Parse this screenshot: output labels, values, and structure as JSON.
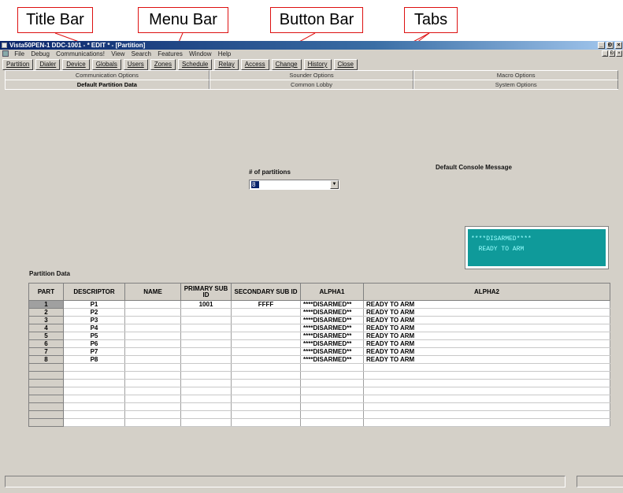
{
  "callouts": {
    "title_bar": "Title Bar",
    "menu_bar": "Menu Bar",
    "button_bar": "Button Bar",
    "tabs": "Tabs"
  },
  "window": {
    "title": "Vista50PEN-1  DDC-1001  - * EDIT * - [Partition]",
    "controls": [
      "_",
      "Ɖ",
      "×"
    ]
  },
  "menu": [
    "File",
    "Debug",
    "Communications!",
    "View",
    "Search",
    "Features",
    "Window",
    "Help"
  ],
  "buttons": [
    "Partition",
    "Dialer",
    "Device",
    "Globals",
    "Users",
    "Zones",
    "Schedule",
    "Relay",
    "Access",
    "Change",
    "History",
    "Close"
  ],
  "tabs": {
    "row1": [
      "Communication Options",
      "Sounder Options",
      "Macro Options"
    ],
    "row2": [
      "Default Partition Data",
      "Common Lobby",
      "System Options"
    ],
    "active": "Default Partition Data"
  },
  "partitions_field": {
    "label": "# of partitions",
    "value": "8"
  },
  "console": {
    "label": "Default Console Message",
    "line1": "****DISARMED****",
    "line2": "  READY TO ARM"
  },
  "partition_data": {
    "label": "Partition Data",
    "columns": [
      "PART",
      "DESCRIPTOR",
      "NAME",
      "PRIMARY SUB ID",
      "SECONDARY SUB ID",
      "ALPHA1",
      "ALPHA2"
    ],
    "rows": [
      [
        "1",
        "P1",
        "",
        "1001",
        "FFFF",
        "****DISARMED**",
        "READY TO ARM"
      ],
      [
        "2",
        "P2",
        "",
        "",
        "",
        "****DISARMED**",
        "READY TO ARM"
      ],
      [
        "3",
        "P3",
        "",
        "",
        "",
        "****DISARMED**",
        "READY TO ARM"
      ],
      [
        "4",
        "P4",
        "",
        "",
        "",
        "****DISARMED**",
        "READY TO ARM"
      ],
      [
        "5",
        "P5",
        "",
        "",
        "",
        "****DISARMED**",
        "READY TO ARM"
      ],
      [
        "6",
        "P6",
        "",
        "",
        "",
        "****DISARMED**",
        "READY TO ARM"
      ],
      [
        "7",
        "P7",
        "",
        "",
        "",
        "****DISARMED**",
        "READY TO ARM"
      ],
      [
        "8",
        "P8",
        "",
        "",
        "",
        "****DISARMED**",
        "READY TO ARM"
      ]
    ],
    "empty_rows": 8
  },
  "colors": {
    "callout_border": "#dd1111",
    "console_bg": "#0f9a9a",
    "title_bg": "#0a246a"
  }
}
